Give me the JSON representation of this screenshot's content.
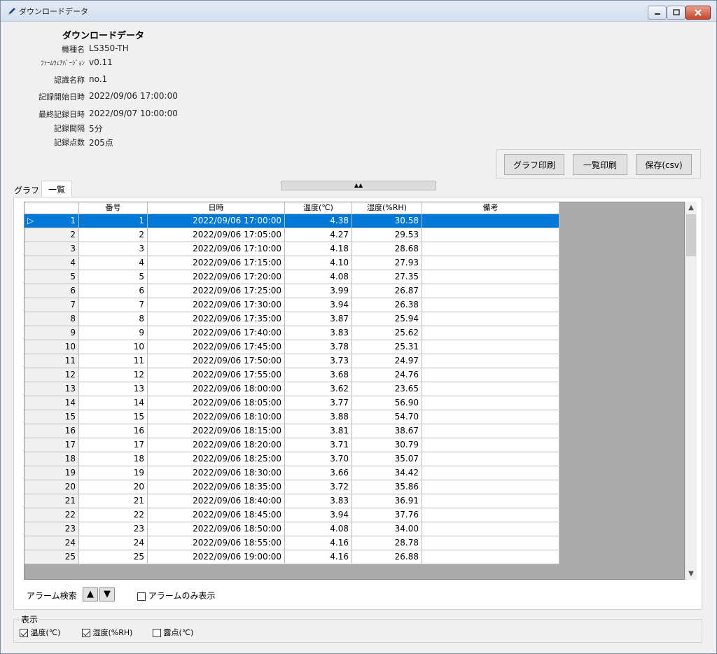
{
  "window": {
    "title": "ダウンロードデータ"
  },
  "header": {
    "title": "ダウンロードデータ"
  },
  "info": [
    {
      "label": "機種名",
      "value": "LS350-TH"
    },
    {
      "label": "ﾌｧｰﾑｳｪｱﾊﾞｰｼﾞｮﾝ",
      "value": "v0.11"
    },
    {
      "label": "認識名称",
      "value": "no.1"
    },
    {
      "label": "記録開始日時",
      "value": "2022/09/06 17:00:00"
    },
    {
      "label": "最終記録日時",
      "value": "2022/09/07 10:00:00"
    },
    {
      "label": "記録間隔",
      "value": "5分"
    },
    {
      "label": "記録点数",
      "value": "205点"
    }
  ],
  "actions": {
    "graph_print": "グラフ印刷",
    "list_print": "一覧印刷",
    "save_csv": "保存(csv)"
  },
  "tabs": {
    "graph": "グラフ",
    "list": "一覧"
  },
  "collapse_glyph": "▲▲",
  "table": {
    "columns": [
      "",
      "番号",
      "日時",
      "温度(℃)",
      "湿度(%RH)",
      "備考"
    ],
    "selected_row_marker": "▷",
    "rows": [
      [
        "1",
        "1",
        "2022/09/06 17:00:00",
        "4.38",
        "30.58",
        ""
      ],
      [
        "2",
        "2",
        "2022/09/06 17:05:00",
        "4.27",
        "29.53",
        ""
      ],
      [
        "3",
        "3",
        "2022/09/06 17:10:00",
        "4.18",
        "28.68",
        ""
      ],
      [
        "4",
        "4",
        "2022/09/06 17:15:00",
        "4.10",
        "27.93",
        ""
      ],
      [
        "5",
        "5",
        "2022/09/06 17:20:00",
        "4.08",
        "27.35",
        ""
      ],
      [
        "6",
        "6",
        "2022/09/06 17:25:00",
        "3.99",
        "26.87",
        ""
      ],
      [
        "7",
        "7",
        "2022/09/06 17:30:00",
        "3.94",
        "26.38",
        ""
      ],
      [
        "8",
        "8",
        "2022/09/06 17:35:00",
        "3.87",
        "25.94",
        ""
      ],
      [
        "9",
        "9",
        "2022/09/06 17:40:00",
        "3.83",
        "25.62",
        ""
      ],
      [
        "10",
        "10",
        "2022/09/06 17:45:00",
        "3.78",
        "25.31",
        ""
      ],
      [
        "11",
        "11",
        "2022/09/06 17:50:00",
        "3.73",
        "24.97",
        ""
      ],
      [
        "12",
        "12",
        "2022/09/06 17:55:00",
        "3.68",
        "24.76",
        ""
      ],
      [
        "13",
        "13",
        "2022/09/06 18:00:00",
        "3.62",
        "23.65",
        ""
      ],
      [
        "14",
        "14",
        "2022/09/06 18:05:00",
        "3.77",
        "56.90",
        ""
      ],
      [
        "15",
        "15",
        "2022/09/06 18:10:00",
        "3.88",
        "54.70",
        ""
      ],
      [
        "16",
        "16",
        "2022/09/06 18:15:00",
        "3.81",
        "38.67",
        ""
      ],
      [
        "17",
        "17",
        "2022/09/06 18:20:00",
        "3.71",
        "30.79",
        ""
      ],
      [
        "18",
        "18",
        "2022/09/06 18:25:00",
        "3.70",
        "35.07",
        ""
      ],
      [
        "19",
        "19",
        "2022/09/06 18:30:00",
        "3.66",
        "34.42",
        ""
      ],
      [
        "20",
        "20",
        "2022/09/06 18:35:00",
        "3.72",
        "35.86",
        ""
      ],
      [
        "21",
        "21",
        "2022/09/06 18:40:00",
        "3.83",
        "36.91",
        ""
      ],
      [
        "22",
        "22",
        "2022/09/06 18:45:00",
        "3.94",
        "37.76",
        ""
      ],
      [
        "23",
        "23",
        "2022/09/06 18:50:00",
        "4.08",
        "34.00",
        ""
      ],
      [
        "24",
        "24",
        "2022/09/06 18:55:00",
        "4.16",
        "28.78",
        ""
      ],
      [
        "25",
        "25",
        "2022/09/06 19:00:00",
        "4.16",
        "26.88",
        ""
      ]
    ]
  },
  "alarm": {
    "label": "アラーム検索",
    "up": "▲",
    "down": "▼",
    "only_label": "アラームのみ表示",
    "only_checked": false
  },
  "display": {
    "legend": "表示",
    "options": [
      {
        "label": "温度(℃)",
        "checked": true
      },
      {
        "label": "湿度(%RH)",
        "checked": true
      },
      {
        "label": "露点(℃)",
        "checked": false
      }
    ]
  },
  "colors": {
    "selection": "#0078d7",
    "grid_empty": "#ababab"
  },
  "icons": {
    "window": "pencil-icon",
    "minimize": "minimize-icon",
    "maximize": "maximize-icon",
    "close": "close-icon"
  }
}
